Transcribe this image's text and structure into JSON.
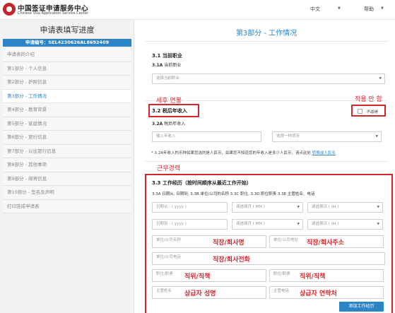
{
  "header": {
    "logo_cn": "中国签证申请服务中心",
    "logo_en": "Chinese Visa Application Service Center",
    "language": "中文",
    "help": "帮助"
  },
  "sidebar": {
    "title": "申请表填写进度",
    "app_no": "申请编号：SEL4230626AL8692409",
    "items": [
      {
        "label": "申请表的介绍"
      },
      {
        "label": "第1部分 - 个人信息"
      },
      {
        "label": "第2部分 - 护照信息"
      },
      {
        "label": "第3部分 - 工作情况",
        "active": true
      },
      {
        "label": "第4部分 - 教育背景"
      },
      {
        "label": "第5部分 - 家庭情况"
      },
      {
        "label": "第6部分 - 旅行信息"
      },
      {
        "label": "第7部分 - 以往旅行信息"
      },
      {
        "label": "第8部分 - 其他事项"
      },
      {
        "label": "第9部分 - 邮寄信息"
      },
      {
        "label": "第10部分 - 签名及声明"
      },
      {
        "label": "打印完成申请表"
      }
    ]
  },
  "main": {
    "page_title": "第3部分 - 工作情况",
    "occupation": {
      "heading": "3.1 当前职业",
      "sub_code": "3.1A",
      "sub_text": "当前职业",
      "select_placeholder": "选择当前职业"
    },
    "income": {
      "heading": "3.2 税后年收入",
      "sub_code": "3.2A",
      "sub_text": "税后年收入",
      "amount_placeholder": "输入年收入",
      "currency_placeholder": "选择一种货币",
      "not_applicable": "不适用",
      "note_text": "* 3.2A年收入的币种如果您选的是人民币，如果您不知道您的年收入是多少人民币，请点此处",
      "note_link": "转换成人民币"
    },
    "work_history": {
      "heading": "3.3 工作经历（按时间顺序从最近工作开始）",
      "legend": "3.3A 日期从, 日期到, 3.3B 单位/公司的名称 3.3C 职位, 3.3D 职位职责 3.3E 主管姓名、电话",
      "date_from": "日期从 - ( yyyy )",
      "date_to": "日期到 - ( yyyy )",
      "month_ph": "请选择月 ( MM )",
      "day_ph": "请选择日 ( dd )",
      "company_name_label": "单位/公司名称",
      "company_address_label": "单位/公司地址",
      "company_phone_label": "单位/公司电话",
      "position_label": "职位/职责",
      "duty_label": "职位/职责",
      "supervisor_name_label": "主管姓名",
      "supervisor_phone_label": "主管电话",
      "add_button": "添加工作经历"
    }
  },
  "annotations": {
    "income_ko": "세후 연봉",
    "na_ko": "적용 안 함",
    "history_ko": "근무경력",
    "company_name_ko": "직장/회사명",
    "company_address_ko": "직장/회사주소",
    "company_phone_ko": "직장/회사전화",
    "position_ko": "직위/직책",
    "duty_ko": "직위/직책",
    "supervisor_name_ko": "상급자 성명",
    "supervisor_phone_ko": "상급자 연락처"
  }
}
